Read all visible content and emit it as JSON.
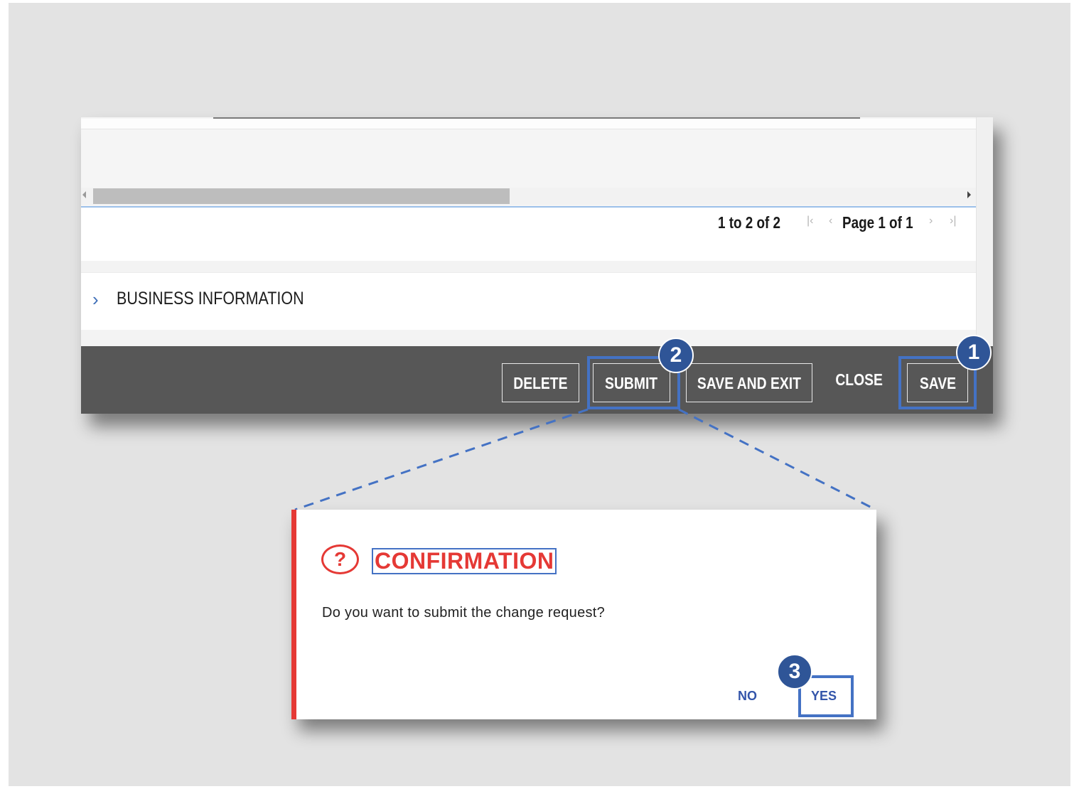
{
  "pager": {
    "count_text": "1 to 2 of 2",
    "first_icon": "first-page-icon",
    "prev_icon": "prev-page-icon",
    "page_text": "Page 1 of 1",
    "next_icon": "next-page-icon",
    "last_icon": "last-page-icon"
  },
  "section": {
    "chevron": "›",
    "title": "BUSINESS INFORMATION"
  },
  "footer": {
    "delete_label": "DELETE",
    "submit_label": "SUBMIT",
    "save_exit_label": "SAVE AND EXIT",
    "close_label": "CLOSE",
    "save_label": "SAVE"
  },
  "annotations": {
    "step_1": "1",
    "step_2": "2",
    "step_3": "3",
    "highlight_color": "#4472c4",
    "badge_color": "#2f5597"
  },
  "dialog": {
    "icon_glyph": "?",
    "title": "CONFIRMATION",
    "message": "Do you want to submit the change request?",
    "no_label": "NO",
    "yes_label": "YES",
    "accent_color": "#e53935"
  }
}
